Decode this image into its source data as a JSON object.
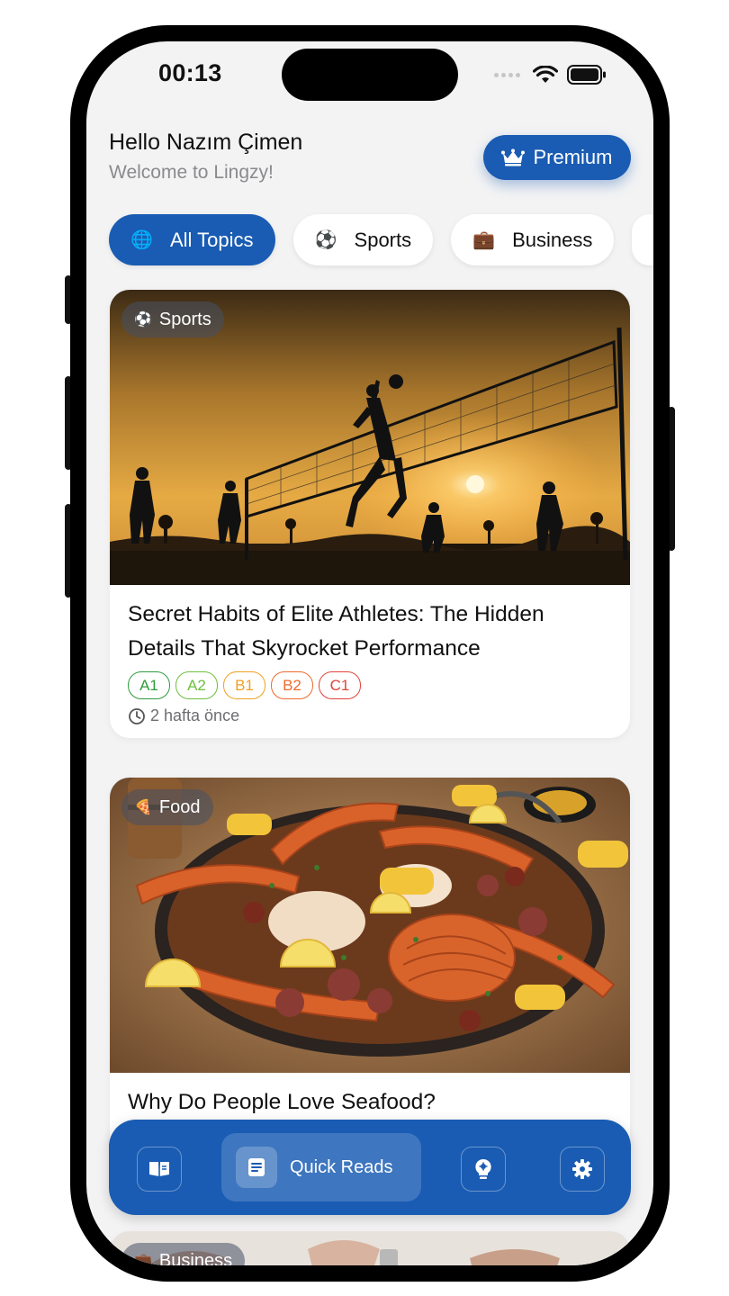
{
  "status_bar": {
    "time": "00:13"
  },
  "header": {
    "greeting": "Hello Nazım Çimen",
    "subtitle": "Welcome to Lingzy!",
    "premium_label": "Premium"
  },
  "topics": [
    {
      "label": "All Topics",
      "icon": "globe-icon",
      "emoji": "🌐",
      "active": true
    },
    {
      "label": "Sports",
      "icon": "soccer-ball-icon",
      "emoji": "⚽",
      "active": false
    },
    {
      "label": "Business",
      "icon": "briefcase-icon",
      "emoji": "💼",
      "active": false
    }
  ],
  "articles": [
    {
      "category": "Sports",
      "category_emoji": "⚽",
      "title": "Secret Habits of Elite Athletes: The Hidden Details That Skyrocket Performance",
      "levels": [
        "A1",
        "A2",
        "B1",
        "B2",
        "C1"
      ],
      "time_ago": "2 hafta önce",
      "image": "volleyball-sunset-photo"
    },
    {
      "category": "Food",
      "category_emoji": "🍕",
      "title": "Why Do People Love Seafood?",
      "image": "seafood-boil-photo"
    },
    {
      "category": "Business",
      "category_emoji": "💼",
      "image": "business-hands-photo"
    }
  ],
  "level_colors": {
    "A1": "#2e9b3e",
    "A2": "#6cbf3a",
    "B1": "#f0a020",
    "B2": "#ee6a2c",
    "C1": "#e0443a"
  },
  "bottom_nav": {
    "active_label": "Quick Reads",
    "items": [
      "book-icon",
      "document-icon",
      "lightbulb-brain-icon",
      "gear-icon"
    ]
  },
  "colors": {
    "primary": "#1a5cb3",
    "background": "#f3f3f4"
  }
}
